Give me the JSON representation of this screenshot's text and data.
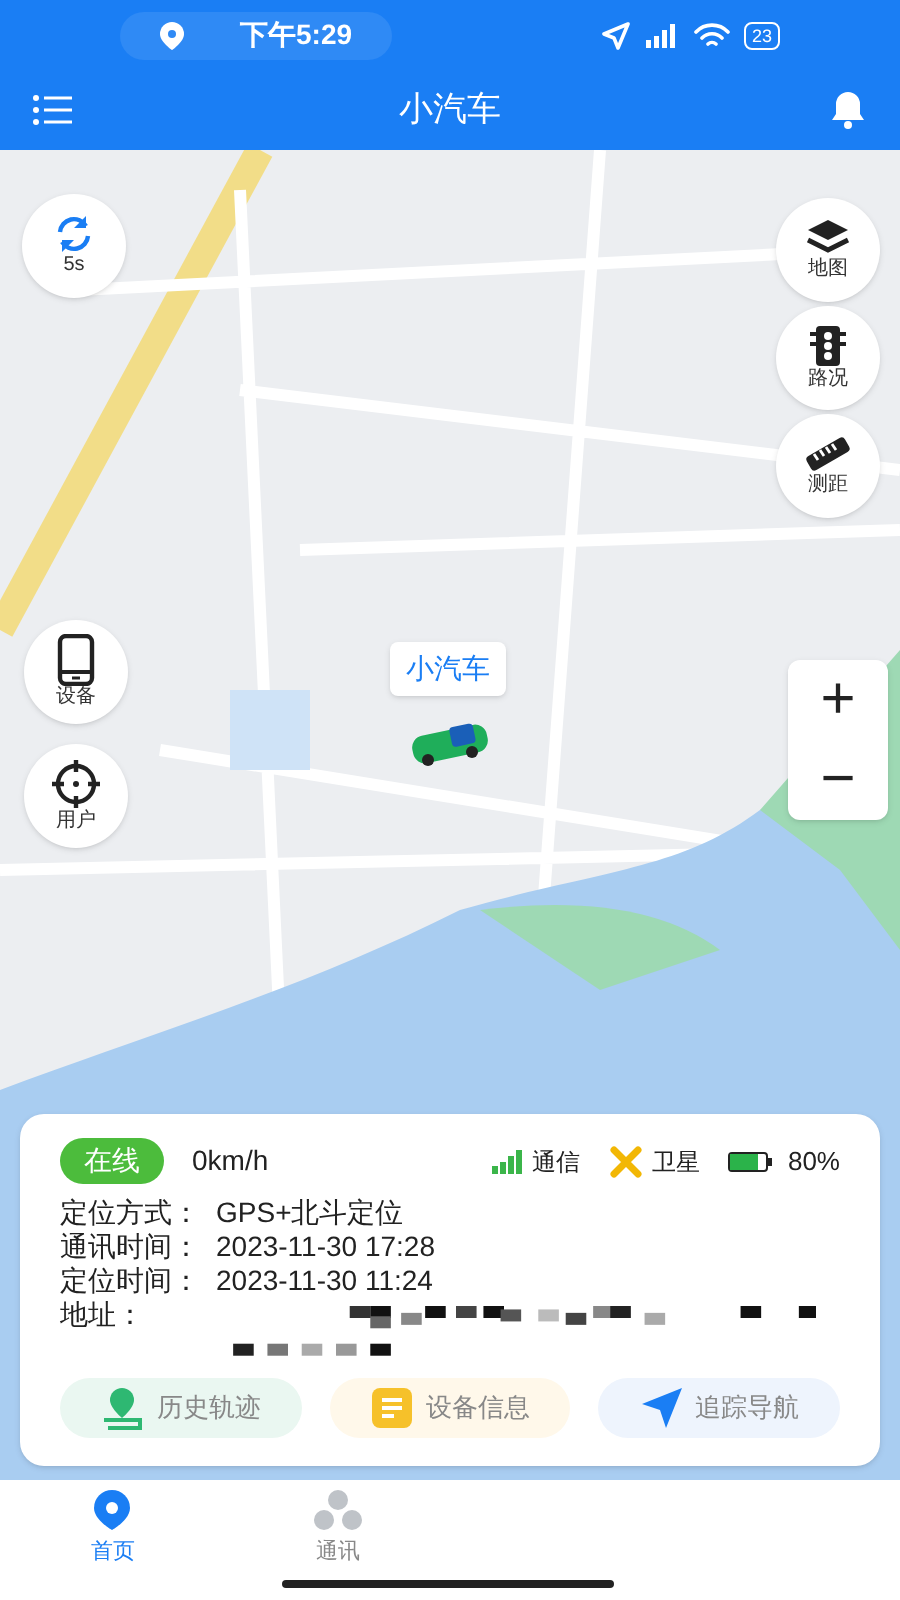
{
  "status_bar": {
    "time": "下午5:29",
    "battery": "23"
  },
  "header": {
    "title": "小汽车"
  },
  "map": {
    "refresh_label": "5s",
    "car_label": "小汽车",
    "right_tools": [
      {
        "kind": "layers",
        "label": "地图"
      },
      {
        "kind": "traffic",
        "label": "路况"
      },
      {
        "kind": "ruler",
        "label": "测距"
      }
    ],
    "left_tools": [
      {
        "kind": "device",
        "label": "设备"
      },
      {
        "kind": "user",
        "label": "用户"
      }
    ],
    "zoom": {
      "plus": "+",
      "minus": "−"
    }
  },
  "card": {
    "status": "在线",
    "online": true,
    "speed": "0km/h",
    "signal_label": "通信",
    "satellite_label": "卫星",
    "battery": "80%",
    "level": 0.8,
    "fields": [
      {
        "label": "定位方式：",
        "value": "GPS+北斗定位"
      },
      {
        "label": "通讯时间：",
        "value": "2023-11-30 17:28"
      },
      {
        "label": "定位时间：",
        "value": "2023-11-30 11:24"
      }
    ],
    "address_label": "地址：",
    "actions": [
      {
        "kind": "history",
        "label": "历史轨迹"
      },
      {
        "kind": "info",
        "label": "设备信息"
      },
      {
        "kind": "navigate",
        "label": "追踪导航"
      }
    ]
  },
  "tabs": [
    {
      "kind": "home",
      "label": "首页",
      "selected": true
    },
    {
      "kind": "chat",
      "label": "通讯",
      "selected": false
    }
  ]
}
